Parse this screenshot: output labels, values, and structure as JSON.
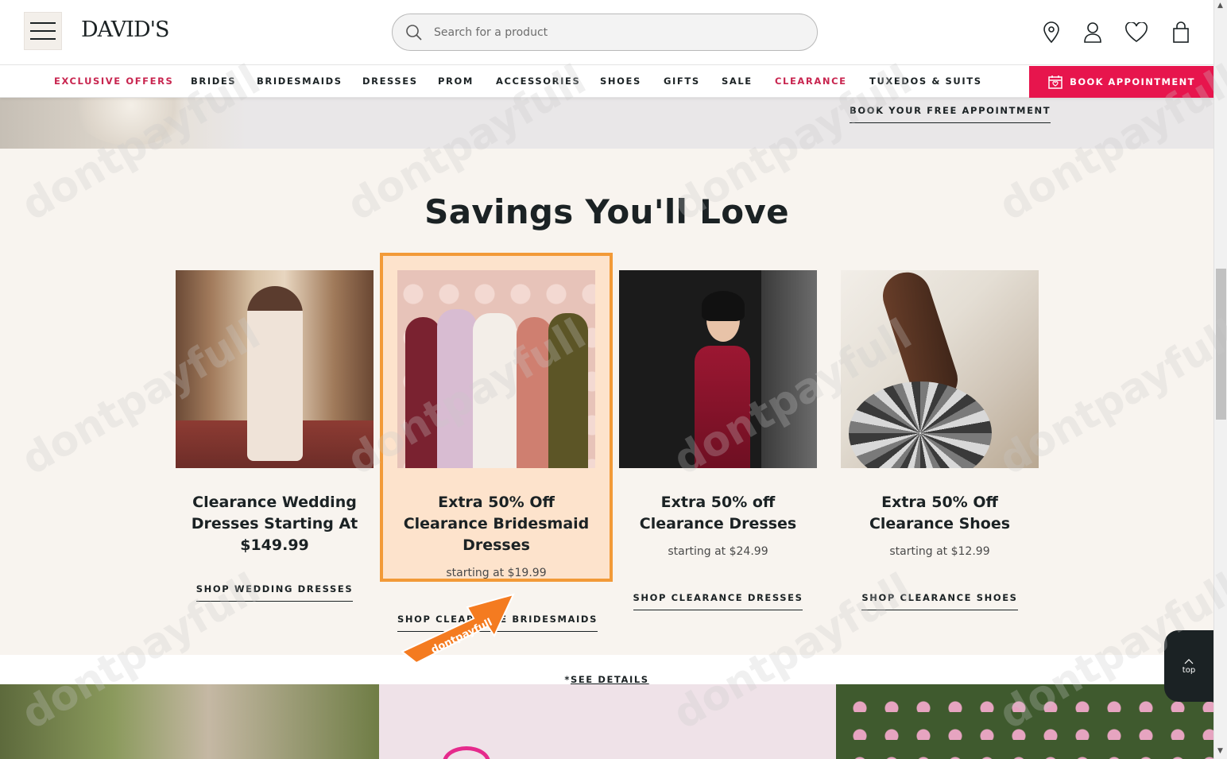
{
  "brand": "DAVID'S",
  "search": {
    "placeholder": "Search for a product"
  },
  "nav": {
    "items": [
      {
        "label": "EXCLUSIVE OFFERS",
        "pink": true
      },
      {
        "label": "BRIDES"
      },
      {
        "label": "BRIDESMAIDS"
      },
      {
        "label": "DRESSES"
      },
      {
        "label": "PROM"
      },
      {
        "label": "ACCESSORIES"
      },
      {
        "label": "SHOES"
      },
      {
        "label": "GIFTS"
      },
      {
        "label": "SALE"
      },
      {
        "label": "CLEARANCE",
        "pink": true
      },
      {
        "label": "TUXEDOS & SUITS"
      }
    ],
    "book_label": "BOOK APPOINTMENT"
  },
  "hero": {
    "link": "BOOK YOUR FREE APPOINTMENT"
  },
  "savings": {
    "title": "Savings You'll Love",
    "cards": [
      {
        "title": "Clearance Wedding Dresses Starting At $149.99",
        "subtitle": "",
        "link": "SHOP WEDDING DRESSES"
      },
      {
        "title": "Extra 50% Off Clearance Bridesmaid Dresses",
        "subtitle": "starting at $19.99",
        "link": "SHOP CLEARANCE BRIDESMAIDS"
      },
      {
        "title": "Extra 50% off Clearance Dresses",
        "subtitle": "starting at $24.99",
        "link": "SHOP CLEARANCE DRESSES"
      },
      {
        "title": "Extra 50% Off Clearance Shoes",
        "subtitle": "starting at $12.99",
        "link": "SHOP CLEARANCE SHOES"
      }
    ]
  },
  "details": {
    "prefix": "*",
    "link": "SEE DETAILS"
  },
  "top_button": "top",
  "watermark": "dontpayfull",
  "colors": {
    "accent_pink": "#e7154d",
    "nav_pink": "#c8254f",
    "highlight_border": "#f29a38",
    "highlight_fill": "#fde3cc",
    "section_bg": "#f8f4ef"
  },
  "icons": [
    "menu-icon",
    "search-icon",
    "location-pin-icon",
    "user-icon",
    "heart-icon",
    "shopping-bag-icon",
    "calendar-icon",
    "chevron-up-icon"
  ]
}
